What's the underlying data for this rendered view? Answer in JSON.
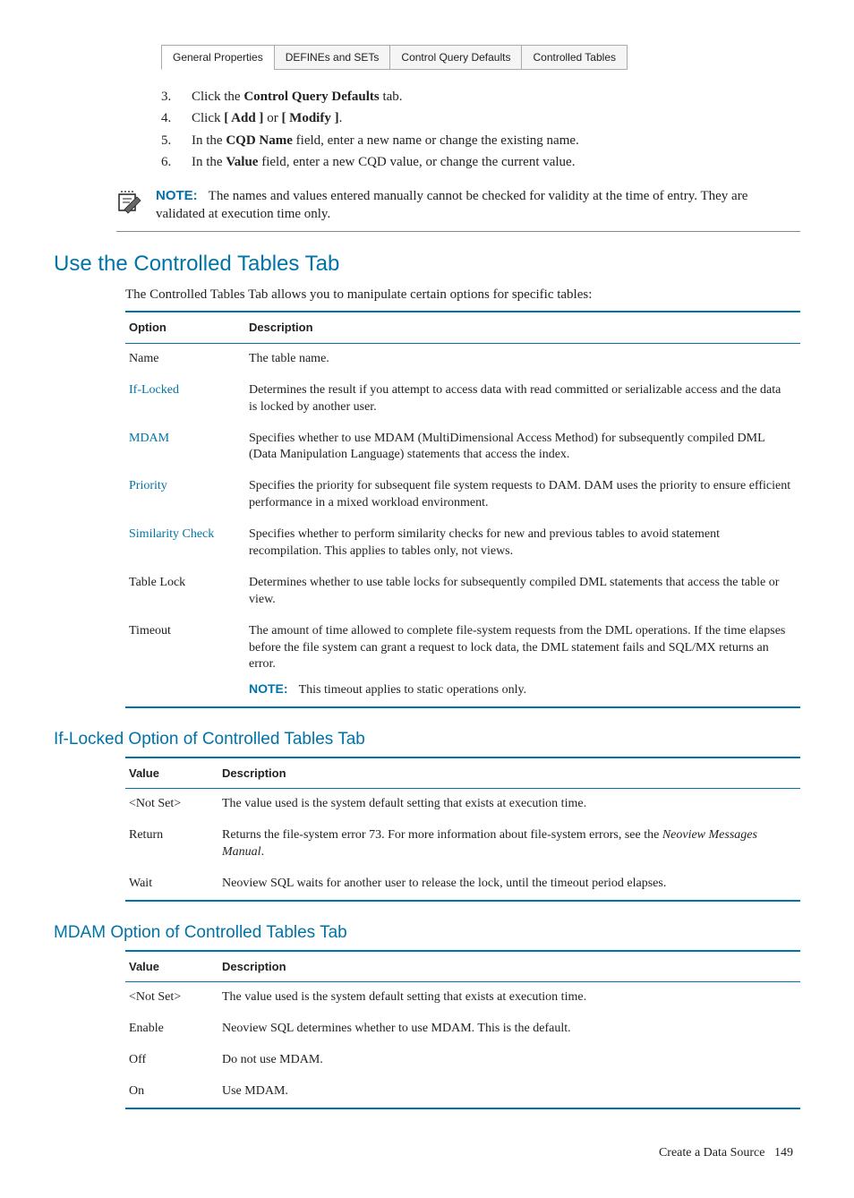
{
  "tabs": {
    "items": [
      {
        "label": "General Properties"
      },
      {
        "label": "DEFINEs and SETs"
      },
      {
        "label": "Control Query Defaults"
      },
      {
        "label": "Controlled Tables"
      }
    ]
  },
  "steps": [
    {
      "n": "3.",
      "pre": "Click the ",
      "bold": "Control Query Defaults",
      "post": " tab."
    },
    {
      "n": "4.",
      "pre": "Click ",
      "bold": "[ Add ]",
      "mid": " or ",
      "bold2": "[ Modify ]",
      "post": "."
    },
    {
      "n": "5.",
      "pre": "In the ",
      "bold": "CQD Name",
      "post": " field, enter a new name or change the existing name."
    },
    {
      "n": "6.",
      "pre": "In the ",
      "bold": "Value",
      "post": " field, enter a new CQD value, or change the current value."
    }
  ],
  "note1": {
    "label": "NOTE:",
    "text": "The names and values entered manually cannot be checked for validity at the time of entry. They are validated at execution time only."
  },
  "section1": {
    "title": "Use the Controlled Tables Tab",
    "intro": "The Controlled Tables Tab allows you to manipulate certain options for specific tables:",
    "col1": "Option",
    "col2": "Description",
    "rows": [
      {
        "opt": "Name",
        "desc": "The table name."
      },
      {
        "opt": "If-Locked",
        "link": true,
        "desc": "Determines the result if you attempt to access data with read committed or serializable access and the data is locked by another user."
      },
      {
        "opt": "MDAM",
        "link": true,
        "desc": "Specifies whether to use MDAM (MultiDimensional Access Method) for subsequently compiled DML (Data Manipulation Language) statements that access the index."
      },
      {
        "opt": "Priority",
        "link": true,
        "desc": "Specifies the priority for subsequent file system requests to DAM. DAM uses the priority to ensure efficient performance in a mixed workload environment."
      },
      {
        "opt": "Similarity Check",
        "link": true,
        "desc": "Specifies whether to perform similarity checks for new and previous tables to avoid statement recompilation. This applies to tables only, not views."
      },
      {
        "opt": "Table Lock",
        "desc": "Determines whether to use table locks for subsequently compiled DML statements that access the table or view."
      },
      {
        "opt": "Timeout",
        "desc": "The amount of time allowed to complete file-system requests from the DML operations. If the time elapses before the file system can grant a request to lock data, the DML statement fails and SQL/MX returns an error.",
        "note_label": "NOTE:",
        "note_text": "This timeout applies to static operations only."
      }
    ]
  },
  "section2": {
    "title": "If-Locked Option of Controlled Tables Tab",
    "col1": "Value",
    "col2": "Description",
    "rows": [
      {
        "val": "<Not Set>",
        "desc": "The value used is the system default setting that exists at execution time."
      },
      {
        "val": "Return",
        "desc_pre": "Returns the file-system error 73. For more information about file-system errors, see the ",
        "desc_italic": "Neoview Messages Manual",
        "desc_post": "."
      },
      {
        "val": "Wait",
        "desc": "Neoview SQL waits for another user to release the lock, until the timeout period elapses."
      }
    ]
  },
  "section3": {
    "title": "MDAM Option of Controlled Tables Tab",
    "col1": "Value",
    "col2": "Description",
    "rows": [
      {
        "val": "<Not Set>",
        "desc": "The value used is the system default setting that exists at execution time."
      },
      {
        "val": "Enable",
        "desc": "Neoview SQL determines whether to use MDAM. This is the default."
      },
      {
        "val": "Off",
        "desc": "Do not use MDAM."
      },
      {
        "val": "On",
        "desc": "Use MDAM."
      }
    ]
  },
  "footer": {
    "title": "Create a Data Source",
    "page": "149"
  }
}
